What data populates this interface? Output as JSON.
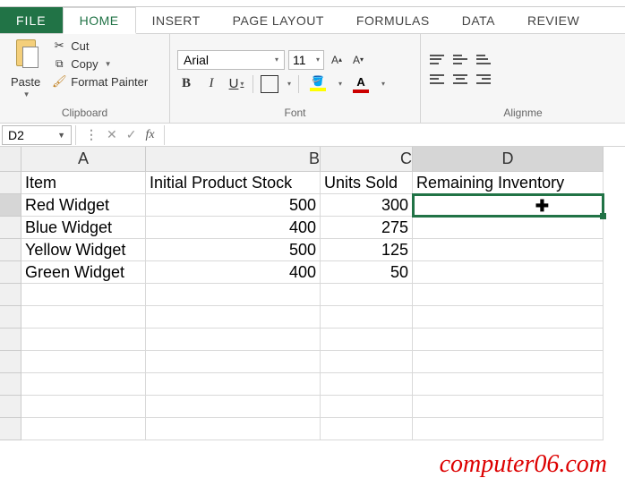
{
  "tabs": {
    "file": "FILE",
    "home": "HOME",
    "insert": "INSERT",
    "pageLayout": "PAGE LAYOUT",
    "formulas": "FORMULAS",
    "data": "DATA",
    "review": "REVIEW"
  },
  "clipboard": {
    "paste": "Paste",
    "cut": "Cut",
    "copy": "Copy",
    "formatPainter": "Format Painter",
    "groupTitle": "Clipboard"
  },
  "font": {
    "name": "Arial",
    "size": "11",
    "bold": "B",
    "italic": "I",
    "underline": "U",
    "colorLetter": "A",
    "groupTitle": "Font"
  },
  "alignment": {
    "groupTitle": "Alignme"
  },
  "formulaBar": {
    "nameBox": "D2",
    "cancel": "✕",
    "enter": "✓",
    "fx": "fx",
    "formula": ""
  },
  "columns": [
    "A",
    "B",
    "C",
    "D"
  ],
  "rows": [
    {
      "n": "",
      "A": "Item",
      "B": "Initial Product Stock",
      "C": "Units Sold",
      "D": "Remaining Inventory"
    },
    {
      "n": "",
      "A": "Red Widget",
      "B": "500",
      "C": "300",
      "D": ""
    },
    {
      "n": "",
      "A": "Blue Widget",
      "B": "400",
      "C": "275",
      "D": ""
    },
    {
      "n": "",
      "A": "Yellow Widget",
      "B": "500",
      "C": "125",
      "D": ""
    },
    {
      "n": "",
      "A": "Green Widget",
      "B": "400",
      "C": "50",
      "D": ""
    },
    {
      "n": "",
      "A": "",
      "B": "",
      "C": "",
      "D": ""
    },
    {
      "n": "",
      "A": "",
      "B": "",
      "C": "",
      "D": ""
    },
    {
      "n": "",
      "A": "",
      "B": "",
      "C": "",
      "D": ""
    },
    {
      "n": "",
      "A": "",
      "B": "",
      "C": "",
      "D": ""
    },
    {
      "n": "",
      "A": "",
      "B": "",
      "C": "",
      "D": ""
    },
    {
      "n": "",
      "A": "",
      "B": "",
      "C": "",
      "D": ""
    },
    {
      "n": "",
      "A": "",
      "B": "",
      "C": "",
      "D": ""
    }
  ],
  "watermark": "computer06.com"
}
